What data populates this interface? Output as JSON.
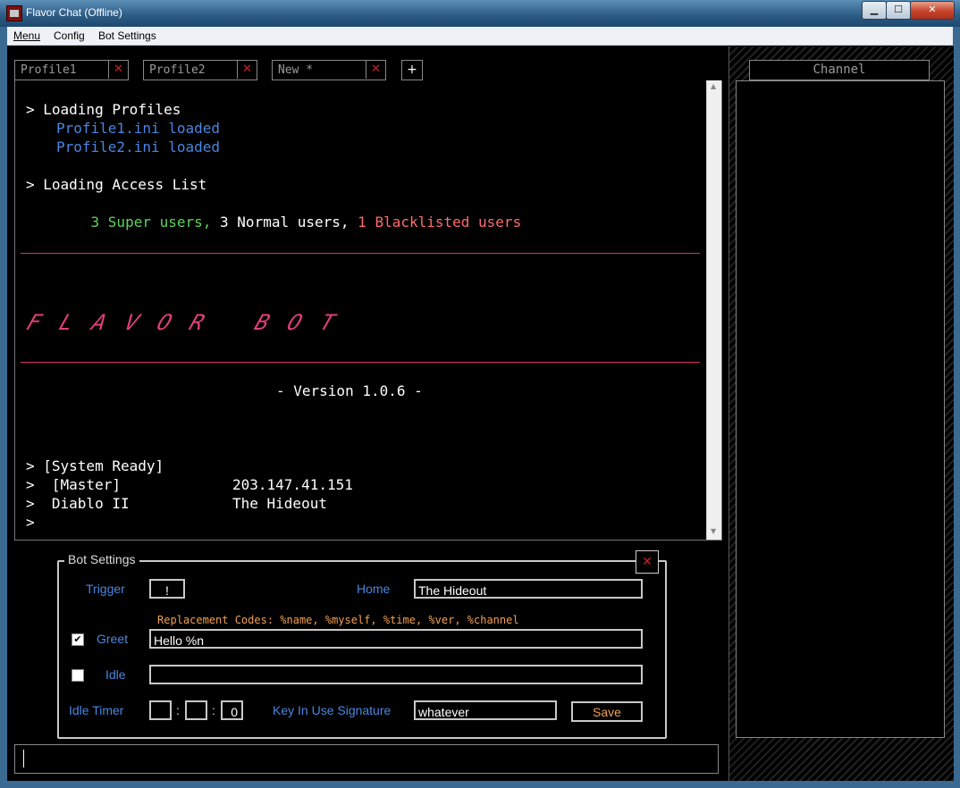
{
  "window": {
    "title": "Flavor Chat (Offline)",
    "min": "▁",
    "max": "☐",
    "close": "✕"
  },
  "menu": {
    "items": [
      "Menu",
      "Config",
      "Bot Settings"
    ]
  },
  "tabs": [
    {
      "label": "Profile1",
      "close": "✕"
    },
    {
      "label": "Profile2",
      "close": "✕"
    },
    {
      "label": "New *",
      "close": "✕"
    }
  ],
  "add_tab": "+",
  "console": {
    "loading_profiles": "> Loading Profiles",
    "profile1": "Profile1.ini loaded",
    "profile2": "Profile2.ini loaded",
    "loading_access": "> Loading Access List",
    "super_users": "3 Super users,",
    "normal_users": "3 Normal users,",
    "blacklisted_users": "1 Blacklisted users",
    "banner": "FLAVOR BOT",
    "version": "- Version 1.0.6 -",
    "system_ready": "> [System Ready]",
    "master_label": ">  [Master]",
    "master_value": "203.147.41.151",
    "game_label": ">  Diablo II",
    "game_value": "The Hideout",
    "prompt": ">"
  },
  "bot_settings": {
    "title": "Bot Settings",
    "close": "✕",
    "trigger_label": "Trigger",
    "trigger_value": "!",
    "home_label": "Home",
    "home_value": "The Hideout",
    "replacement_codes": "Replacement Codes: %name, %myself, %time, %ver, %channel",
    "greet_label": "Greet",
    "greet_checked": true,
    "greet_value": "Hello %n",
    "idle_label": "Idle",
    "idle_checked": false,
    "idle_value": "",
    "idle_timer_label": "Idle Timer",
    "idle_timer": [
      "",
      "",
      "0"
    ],
    "timer_sep": ":",
    "key_label": "Key In Use Signature",
    "key_value": "whatever",
    "save_label": "Save"
  },
  "channel": {
    "title": "Channel"
  },
  "colors": {
    "accent_blue": "#4a86e0",
    "green": "#5fd35f",
    "red": "#ff6b6b",
    "pink": "#e0407a",
    "orange": "#f0a050"
  }
}
